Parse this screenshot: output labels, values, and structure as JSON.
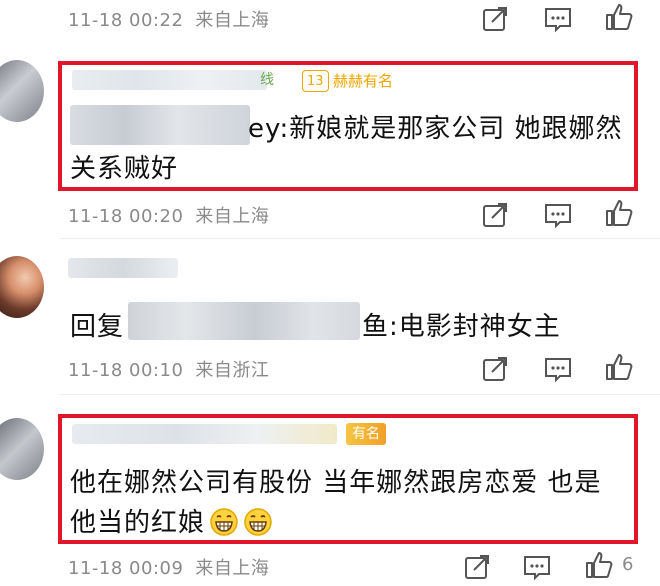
{
  "comments": [
    {
      "time": "11-18 00:22",
      "location": "来自上海"
    },
    {
      "level": "13",
      "fan_badge": "赫赫有名",
      "partial_name": "线",
      "reply_prefix_tail": "ey:",
      "text_line1": "新娘就是那家公司 她跟娜然",
      "text_line2": "关系贼好",
      "time": "11-18 00:20",
      "location": "来自上海"
    },
    {
      "reply_start": "回复",
      "reply_tail": "鱼:",
      "text": "电影封神女主",
      "time": "11-18 00:10",
      "location": "来自浙江"
    },
    {
      "fan_badge": "有名",
      "text_line1": "他在娜然公司有股份 当年娜然跟房恋爱 也是",
      "text_line2": "他当的红娘",
      "time": "11-18 00:09",
      "location": "来自上海",
      "like_count": "6"
    }
  ],
  "icons": {
    "repost": "repost-icon",
    "comment": "comment-icon",
    "like": "like-icon",
    "emoji": "grin-emoji-icon"
  },
  "colors": {
    "highlight_border": "#e0162b",
    "meta_text": "#8a8a8a",
    "badge_gold": "#f0a500"
  }
}
